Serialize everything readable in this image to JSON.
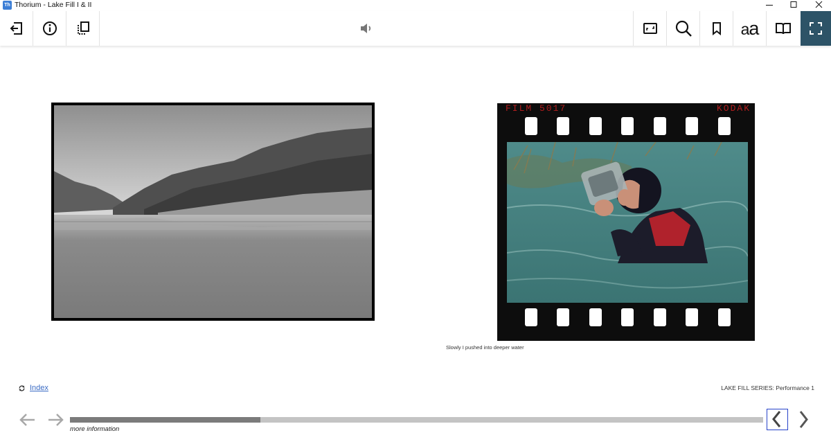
{
  "window": {
    "app_icon_text": "Th",
    "title": "Thorium - Lake Fill I & II"
  },
  "toolbar": {
    "left_icons": [
      "exit-icon",
      "info-icon",
      "pages-icon"
    ],
    "center_icons": [
      "speaker-icon"
    ],
    "right_icons": [
      "picture-icon",
      "search-icon",
      "bookmark-icon",
      "font-size-icon",
      "book-icon",
      "fullscreen-icon"
    ],
    "font_label_small": "a",
    "font_label_big": "a",
    "accent_color": "#2d5367"
  },
  "content": {
    "film_text_left": "FILM  5017",
    "film_text_right": "KODAK",
    "caption": "Slowly I pushed into deeper water",
    "index_link": "Index",
    "series_label": "LAKE FILL SERIES: Performance 1"
  },
  "footer": {
    "more_info": "more information",
    "progress": 0.275,
    "link_color": "#3a6bc4",
    "focus_color": "#2642c9"
  }
}
